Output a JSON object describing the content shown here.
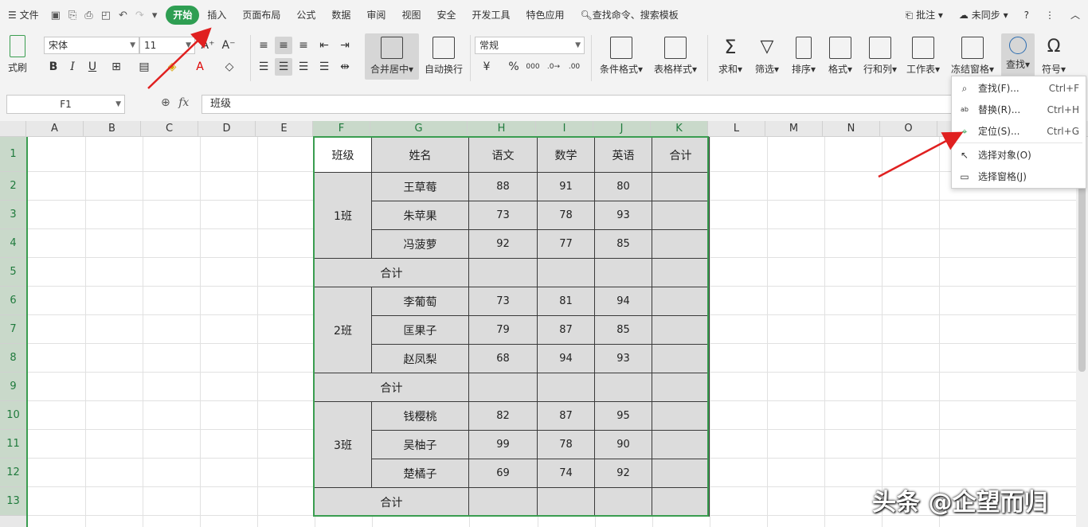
{
  "menu": {
    "file": "文件",
    "items": [
      "开始",
      "插入",
      "页面布局",
      "公式",
      "数据",
      "审阅",
      "视图",
      "安全",
      "开发工具",
      "特色应用"
    ],
    "search": "查找命令、搜索模板",
    "comment": "批注",
    "sync": "未同步",
    "help": "?"
  },
  "ribbon": {
    "brush_label": "式刷",
    "font_name": "宋体",
    "font_size": "11",
    "merge_label": "合并居中",
    "wrap_label": "自动换行",
    "number_format": "常规",
    "cond_format": "条件格式",
    "table_style": "表格样式",
    "sum": "求和",
    "filter": "筛选",
    "sort": "排序",
    "format": "格式",
    "rowcol": "行和列",
    "sheet": "工作表",
    "freeze": "冻结窗格",
    "find": "查找",
    "symbol": "符号"
  },
  "formula_bar": {
    "name_box": "F1",
    "fx": "fx",
    "content": "班级"
  },
  "columns": [
    "A",
    "B",
    "C",
    "D",
    "E",
    "F",
    "G",
    "H",
    "I",
    "J",
    "K",
    "L",
    "M",
    "N",
    "O"
  ],
  "rows": [
    "1",
    "2",
    "3",
    "4",
    "5",
    "6",
    "7",
    "8",
    "9",
    "10",
    "11",
    "12",
    "13"
  ],
  "table": {
    "headers": [
      "班级",
      "姓名",
      "语文",
      "数学",
      "英语",
      "合计"
    ],
    "groups": [
      {
        "class": "1班",
        "students": [
          [
            "王草莓",
            "88",
            "91",
            "80"
          ],
          [
            "朱苹果",
            "73",
            "78",
            "93"
          ],
          [
            "冯菠萝",
            "92",
            "77",
            "85"
          ]
        ],
        "total": "合计"
      },
      {
        "class": "2班",
        "students": [
          [
            "李葡萄",
            "73",
            "81",
            "94"
          ],
          [
            "匡果子",
            "79",
            "87",
            "85"
          ],
          [
            "赵凤梨",
            "68",
            "94",
            "93"
          ]
        ],
        "total": "合计"
      },
      {
        "class": "3班",
        "students": [
          [
            "钱樱桃",
            "82",
            "87",
            "95"
          ],
          [
            "吴柚子",
            "99",
            "78",
            "90"
          ],
          [
            "楚橘子",
            "69",
            "74",
            "92"
          ]
        ],
        "total": "合计"
      }
    ]
  },
  "dropdown": [
    {
      "label": "查找(F)...",
      "shortcut": "Ctrl+F",
      "icon": "search-icon"
    },
    {
      "label": "替换(R)...",
      "shortcut": "Ctrl+H",
      "icon": "replace-icon"
    },
    {
      "label": "定位(S)...",
      "shortcut": "Ctrl+G",
      "icon": "locate-icon"
    },
    {
      "label": "选择对象(O)",
      "shortcut": "",
      "icon": "cursor-icon"
    },
    {
      "label": "选择窗格(J)",
      "shortcut": "",
      "icon": "pane-icon"
    }
  ],
  "watermark": "头条 @企望而归",
  "colors": {
    "accent": "#2e9e52",
    "selection": "#3a9d50",
    "cell_fill": "#dcdcdc",
    "arrow": "#e02020"
  }
}
